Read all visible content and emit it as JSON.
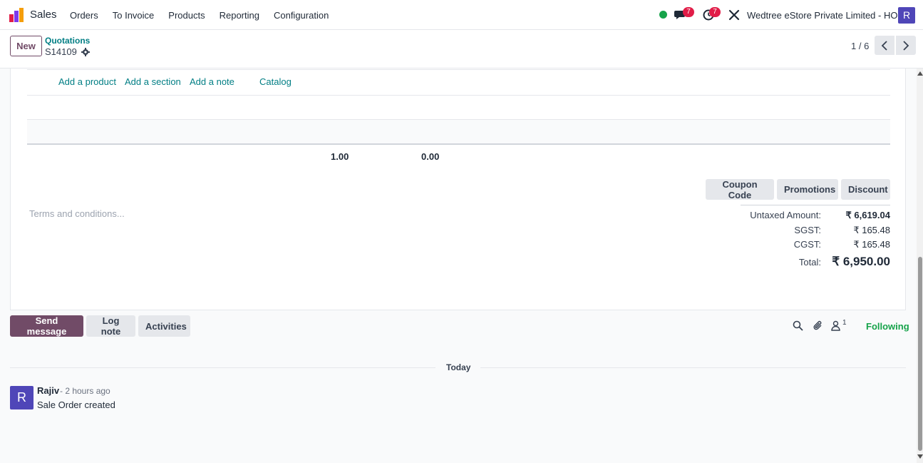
{
  "nav": {
    "app_name": "Sales",
    "menu": [
      "Orders",
      "To Invoice",
      "Products",
      "Reporting",
      "Configuration"
    ],
    "chat_badge": "7",
    "activity_badge": "7",
    "company": "Wedtree eStore Private Limited - HO",
    "user_initial": "R"
  },
  "control": {
    "new_label": "New",
    "breadcrumb": "Quotations",
    "record": "S14109",
    "pager": "1 / 6"
  },
  "lines": {
    "add_product": "Add a product",
    "add_section": "Add a section",
    "add_note": "Add a note",
    "catalog": "Catalog",
    "sum_qty": "1.00",
    "sum_other": "0.00"
  },
  "promo": {
    "coupon": "Coupon Code",
    "promotions": "Promotions",
    "discount": "Discount"
  },
  "terms_placeholder": "Terms and conditions...",
  "totals": {
    "untaxed_label": "Untaxed Amount:",
    "untaxed_value": "₹ 6,619.04",
    "sgst_label": "SGST:",
    "sgst_value": "₹ 165.48",
    "cgst_label": "CGST:",
    "cgst_value": "₹ 165.48",
    "total_label": "Total:",
    "total_value": "₹ 6,950.00"
  },
  "chatter": {
    "send_message": "Send message",
    "log_note": "Log note",
    "activities": "Activities",
    "follower_count": "1",
    "following": "Following",
    "date_separator": "Today",
    "message": {
      "author_initial": "R",
      "author": "Rajiv",
      "time": "- 2 hours ago",
      "body": "Sale Order created"
    }
  },
  "colors": {
    "brand": "#714b67",
    "link": "#017e84",
    "avatar": "#4f46b8",
    "following": "#16a34a",
    "badge": "#e11d48"
  }
}
